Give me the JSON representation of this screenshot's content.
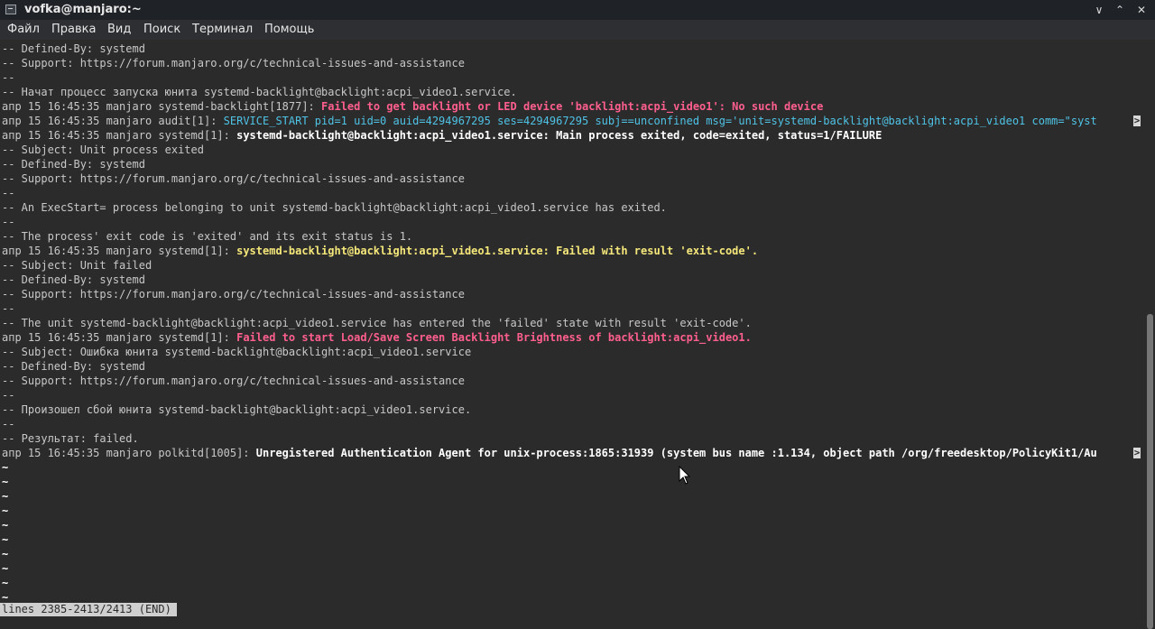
{
  "window": {
    "title": "vofka@manjaro:~",
    "icon": "terminal-icon",
    "minimize_icon": "∨",
    "maximize_icon": "⌃",
    "close_icon": "✕"
  },
  "menu": [
    "Файл",
    "Правка",
    "Вид",
    "Поиск",
    "Терминал",
    "Помощь"
  ],
  "log": {
    "l0": "-- Defined-By: systemd",
    "l1": "-- Support: https://forum.manjaro.org/c/technical-issues-and-assistance",
    "l2": "--",
    "l3": "-- Начат процесс запуска юнита systemd-backlight@backlight:acpi_video1.service.",
    "l4_prefix": "апр 15 16:45:35 manjaro systemd-backlight[1877]: ",
    "l4_msg": "Failed to get backlight or LED device 'backlight:acpi_video1': No such device",
    "l5_prefix": "апр 15 16:45:35 manjaro audit[1]: ",
    "l5_msg": "SERVICE_START pid=1 uid=0 auid=4294967295 ses=4294967295 subj==unconfined msg='unit=systemd-backlight@backlight:acpi_video1 comm=\"syst",
    "l6_prefix": "апр 15 16:45:35 manjaro systemd[1]: ",
    "l6_msg": "systemd-backlight@backlight:acpi_video1.service: Main process exited, code=exited, status=1/FAILURE",
    "l7": "-- Subject: Unit process exited",
    "l8": "-- Defined-By: systemd",
    "l9": "-- Support: https://forum.manjaro.org/c/technical-issues-and-assistance",
    "l10": "--",
    "l11": "-- An ExecStart= process belonging to unit systemd-backlight@backlight:acpi_video1.service has exited.",
    "l12": "--",
    "l13": "-- The process' exit code is 'exited' and its exit status is 1.",
    "l14_prefix": "апр 15 16:45:35 manjaro systemd[1]: ",
    "l14_msg": "systemd-backlight@backlight:acpi_video1.service: Failed with result 'exit-code'.",
    "l15": "-- Subject: Unit failed",
    "l16": "-- Defined-By: systemd",
    "l17": "-- Support: https://forum.manjaro.org/c/technical-issues-and-assistance",
    "l18": "--",
    "l19": "-- The unit systemd-backlight@backlight:acpi_video1.service has entered the 'failed' state with result 'exit-code'.",
    "l20_prefix": "апр 15 16:45:35 manjaro systemd[1]: ",
    "l20_msg": "Failed to start Load/Save Screen Backlight Brightness of backlight:acpi_video1.",
    "l21": "-- Subject: Ошибка юнита systemd-backlight@backlight:acpi_video1.service",
    "l22": "-- Defined-By: systemd",
    "l23": "-- Support: https://forum.manjaro.org/c/technical-issues-and-assistance",
    "l24": "--",
    "l25": "-- Произошел сбой юнита systemd-backlight@backlight:acpi_video1.service.",
    "l26": "--",
    "l27": "-- Результат: failed.",
    "l28_prefix": "апр 15 16:45:35 manjaro polkitd[1005]: ",
    "l28_msg": "Unregistered Authentication Agent for unix-process:1865:31939 (system bus name :1.134, object path /org/freedesktop/PolicyKit1/Au",
    "truncation_marker": ">",
    "tilde": "~"
  },
  "status": "lines 2385-2413/2413 (END)"
}
